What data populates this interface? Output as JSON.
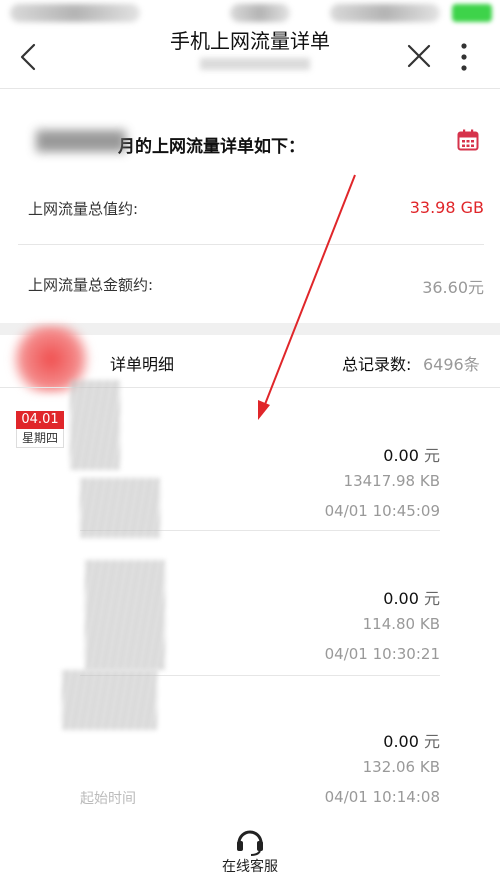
{
  "nav": {
    "title": "手机上网流量详单"
  },
  "summary": {
    "heading": "月的上网流量详单如下：",
    "total_traffic_label": "上网流量总值约:",
    "total_traffic_value": "33.98 GB",
    "total_amount_label": "上网流量总金额约:",
    "total_amount_value": "36.60元"
  },
  "detail": {
    "title": "详单明细",
    "record_count_label": "总记录数:",
    "record_count_value": "6496条"
  },
  "date_badge": {
    "date": "04.01",
    "weekday": "星期四"
  },
  "records": [
    {
      "amount": "0.00",
      "unit": "元",
      "size": "13417.98 KB",
      "time": "04/01 10:45:09"
    },
    {
      "amount": "0.00",
      "unit": "元",
      "size": "114.80 KB",
      "time": "04/01 10:30:21"
    },
    {
      "amount": "0.00",
      "unit": "元",
      "size": "132.06 KB",
      "time": "04/01 10:14:08",
      "start_label": "起始时间"
    }
  ],
  "footer": {
    "label": "在线客服"
  },
  "colors": {
    "accent_red": "#e0262a",
    "calendar": "#d6334b"
  }
}
